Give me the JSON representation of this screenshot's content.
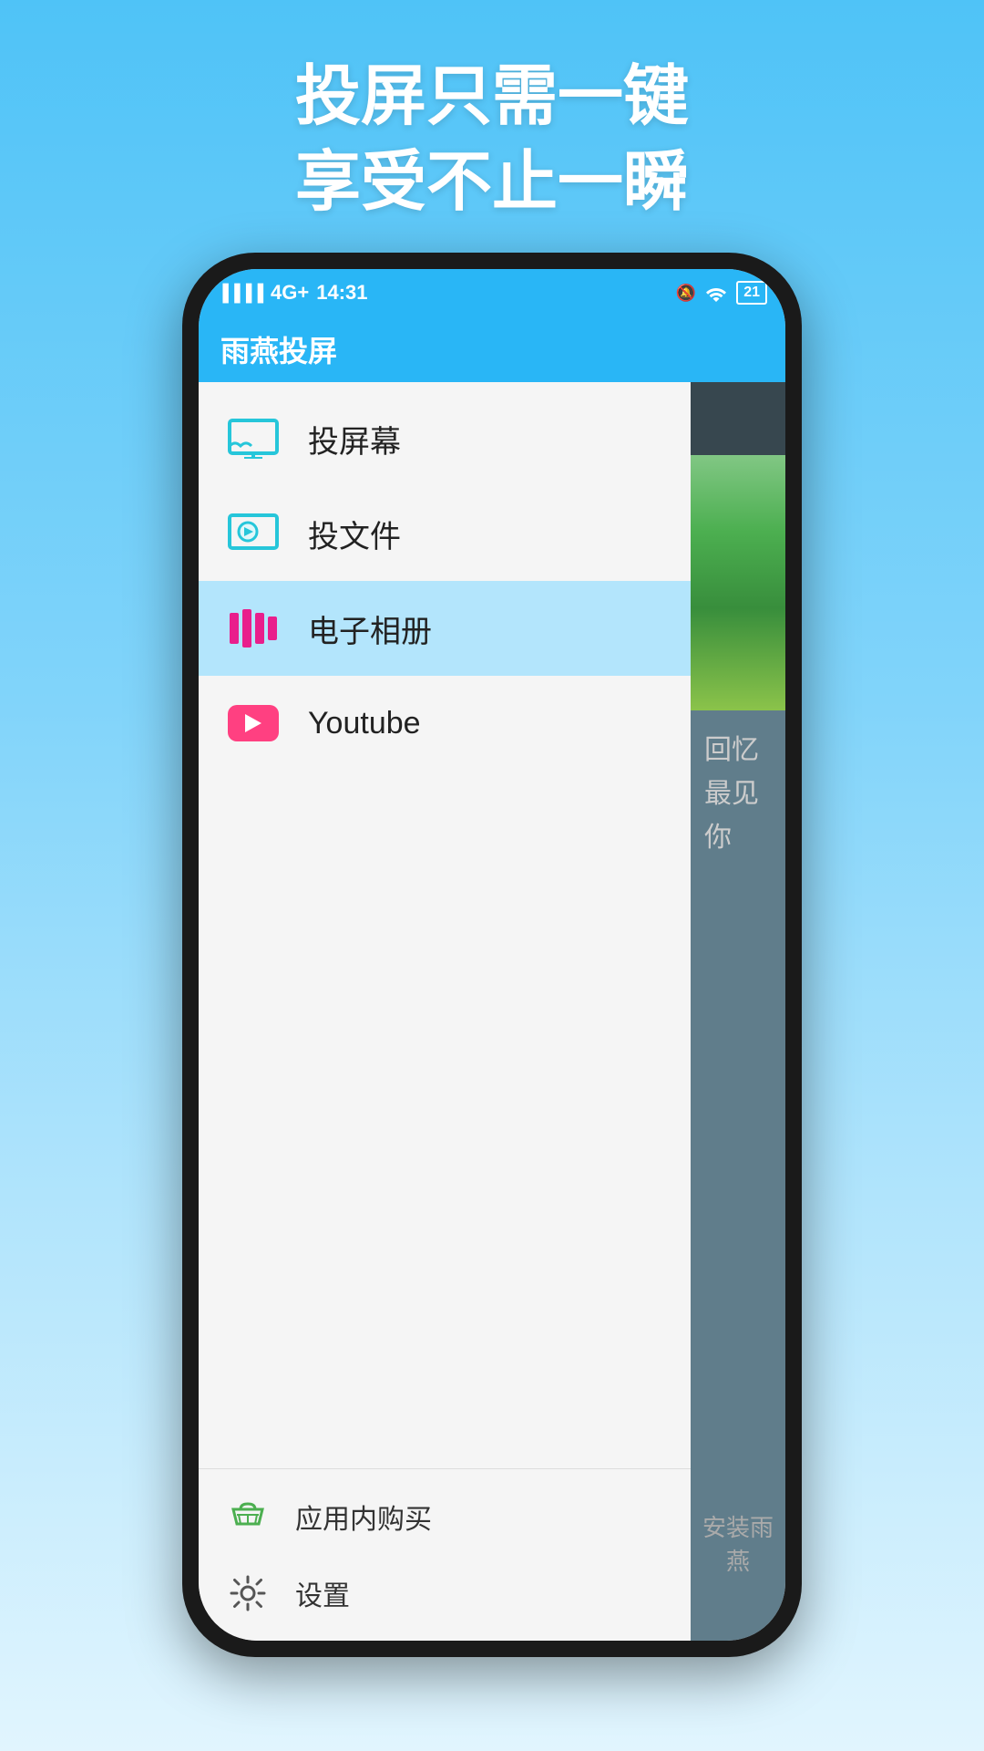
{
  "page": {
    "background": "linear-gradient(180deg, #4fc3f7, #e1f5fe)",
    "top_tagline_line1": "投屏只需一键",
    "top_tagline_line2": "享受不止一瞬"
  },
  "status_bar": {
    "network": "4G+",
    "time": "14:31",
    "battery": "21"
  },
  "app_bar": {
    "title": "雨燕投屏"
  },
  "drawer": {
    "nav_items": [
      {
        "id": "cast-screen",
        "label": "投屏幕",
        "icon": "cast-screen-icon",
        "active": false
      },
      {
        "id": "cast-file",
        "label": "投文件",
        "icon": "cast-file-icon",
        "active": false
      },
      {
        "id": "photo-album",
        "label": "电子相册",
        "icon": "photo-album-icon",
        "active": true
      },
      {
        "id": "youtube",
        "label": "Youtube",
        "icon": "youtube-icon",
        "active": false
      }
    ],
    "footer_items": [
      {
        "id": "purchase",
        "label": "应用内购买",
        "icon": "basket-icon"
      },
      {
        "id": "settings",
        "label": "设置",
        "icon": "settings-icon"
      }
    ]
  },
  "right_panel": {
    "text_line1": "回忆",
    "text_line2": "最见你",
    "install_text": "安装雨燕"
  }
}
